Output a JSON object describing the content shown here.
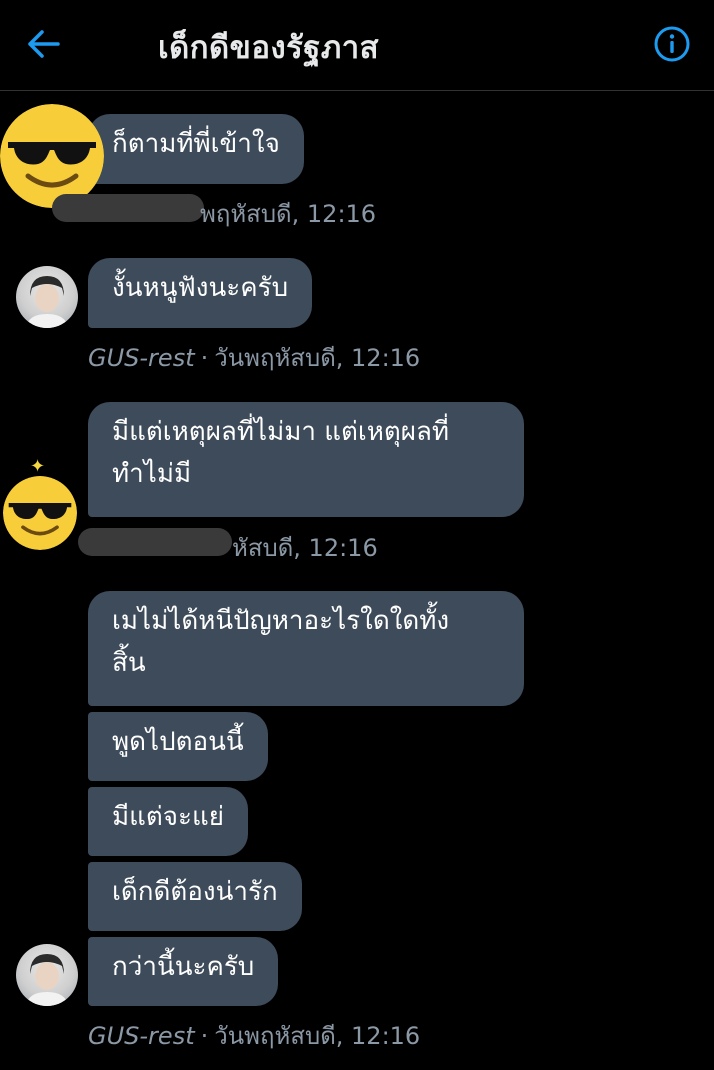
{
  "header": {
    "title": "เด็กดีของรัฐภาส",
    "back_icon": "arrow-left-icon",
    "info_icon": "info-icon",
    "accent_color": "#1d9bf0"
  },
  "messages": [
    {
      "sender": "",
      "text": "ก็ตามที่พี่เข้าใจ",
      "meta": "พฤหัสบดี, 12:16",
      "avatar": "sunglasses-emoji"
    },
    {
      "sender": "GUS-rest",
      "text": "งั้นหนูฟังนะครับ",
      "meta": "วันพฤหัสบดี, 12:16",
      "avatar": "profile-photo"
    },
    {
      "sender": "",
      "text_lines": [
        "มีแต่เหตุผลที่ไม่มา แต่เหตุผลที่",
        "ทำไม่มี"
      ],
      "meta": "หัสบดี, 12:16",
      "avatar": "sunglasses-emoji"
    },
    {
      "sender": "GUS-rest",
      "group": [
        {
          "text_lines": [
            "เมไม่ได้หนีปัญหาอะไรใดใดทั้ง",
            "สิ้น"
          ]
        },
        {
          "text": "พูดไปตอนนี้"
        },
        {
          "text": "มีแต่จะแย่"
        },
        {
          "text": "เด็กดีต้องน่ารัก"
        },
        {
          "text": "กว่านี้นะครับ"
        }
      ],
      "meta": "วันพฤหัสบดี, 12:16",
      "avatar": "profile-photo"
    }
  ],
  "colors": {
    "bubble": "#3d4b5a",
    "meta_text": "#8b98a5",
    "emoji": "#f7cd3a"
  }
}
